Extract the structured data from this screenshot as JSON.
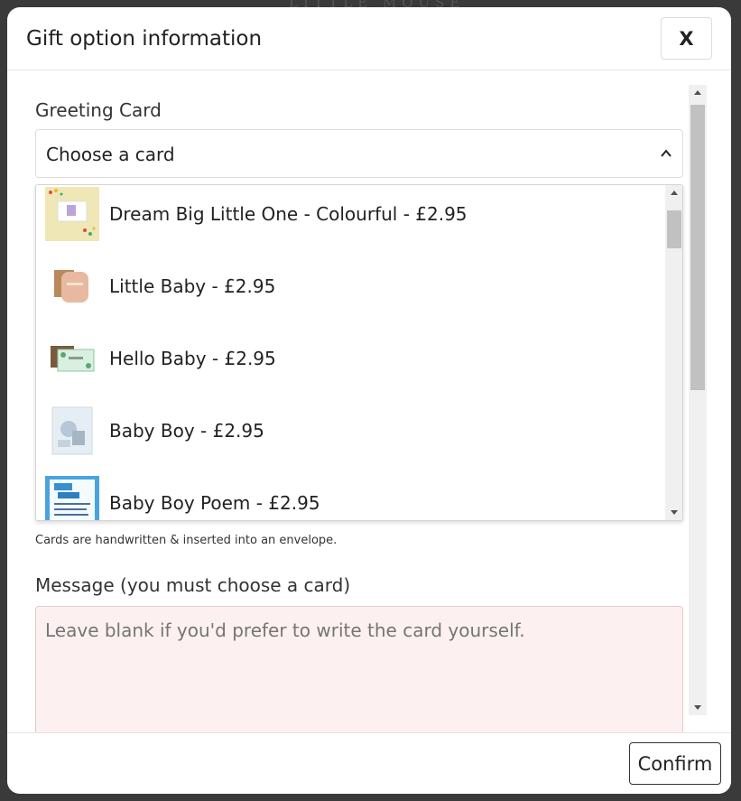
{
  "background": {
    "logo_text": "LITTLE MOUSE"
  },
  "modal": {
    "title": "Gift option information",
    "close_label": "X"
  },
  "greeting_card": {
    "label": "Greeting Card",
    "selected": "Choose a card",
    "options": [
      {
        "label": "Dream Big Little One - Colourful - £2.95",
        "thumb": "dream-big-card-thumbnail"
      },
      {
        "label": "Little Baby - £2.95",
        "thumb": "little-baby-card-thumbnail"
      },
      {
        "label": "Hello Baby - £2.95",
        "thumb": "hello-baby-card-thumbnail"
      },
      {
        "label": "Baby Boy - £2.95",
        "thumb": "baby-boy-card-thumbnail"
      },
      {
        "label": "Baby Boy Poem - £2.95",
        "thumb": "baby-boy-poem-card-thumbnail"
      }
    ],
    "helper": "Cards are handwritten & inserted into an envelope."
  },
  "message": {
    "label": "Message (you must choose a card)",
    "placeholder": "Leave blank if you'd prefer to write the card yourself."
  },
  "footer": {
    "confirm_label": "Confirm"
  },
  "colors": {
    "message_background": "#fdf0f0",
    "backdrop": "#3a3a3a"
  }
}
